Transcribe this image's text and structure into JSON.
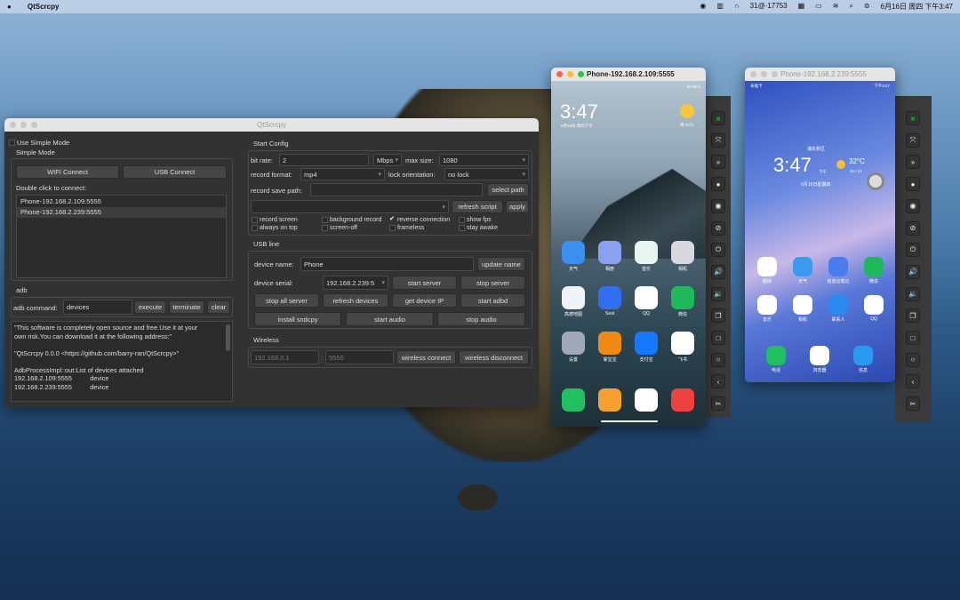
{
  "menubar": {
    "app": "QtScrcpy",
    "status_text": "31@·17753",
    "datetime": "6月16日 周四 下午3:47",
    "icons": [
      "android-icon",
      "bars-icon",
      "headphones-icon",
      "cloud-icon",
      "grid-icon",
      "battery-icon",
      "wifi-icon",
      "search-icon",
      "control-center-icon"
    ]
  },
  "main": {
    "title": "QtScrcpy",
    "use_simple_mode": "Use Simple Mode",
    "simple_mode": "Simple Mode",
    "wifi_connect": "WIFI Connect",
    "usb_connect": "USB Connect",
    "double_click": "Double click to connect:",
    "devices": [
      "Phone-192.168.2.109:5555",
      "Phone-192.168.2.239:5555"
    ],
    "adb": "adb",
    "adb_command_label": "adb command:",
    "adb_command": "devices",
    "execute": "execute",
    "terminate": "terminate",
    "clear": "clear",
    "log": "\"This software is completely open source and free.Use it at your\nown risk.You can download it at the following address:\"\n\n\"QtScrcpy 0.0.0 <https://github.com/barry-ran/QtScrcpy>\"\n\nAdbProcessImpl::out:List of devices attached\n192.168.2.109:5555          device\n192.168.2.239:5555          device",
    "start_config": "Start Config",
    "bit_rate_label": "bit rate:",
    "bit_rate": "2",
    "bit_unit": "Mbps",
    "max_size_label": "max size:",
    "max_size": "1080",
    "record_format_label": "record format:",
    "record_format": "mp4",
    "lock_orientation_label": "lock orientation:",
    "lock_orientation": "no lock",
    "record_save_path_label": "record save path:",
    "record_save_path": "",
    "select_path": "select path",
    "script": "",
    "refresh_script": "refresh script",
    "apply": "apply",
    "checkboxes": [
      {
        "label": "record screen",
        "checked": false
      },
      {
        "label": "background record",
        "checked": false
      },
      {
        "label": "reverse connection",
        "checked": true
      },
      {
        "label": "show fps",
        "checked": false
      },
      {
        "label": "always on top",
        "checked": false
      },
      {
        "label": "screen-off",
        "checked": false
      },
      {
        "label": "frameless",
        "checked": false
      },
      {
        "label": "stay awake",
        "checked": false
      }
    ],
    "usb_line": "USB line",
    "device_name_label": "device name:",
    "device_name": "Phone",
    "update_name": "update name",
    "device_serial_label": "device serial:",
    "device_serial": "192.168.2.239:5",
    "start_server": "start server",
    "stop_server": "stop server",
    "stop_all_server": "stop all server",
    "refresh_devices": "refresh devices",
    "get_device_ip": "get device IP",
    "start_adbd": "start adbd",
    "install_sndcpy": "install sndcpy",
    "start_audio": "start audio",
    "stop_audio": "stop audio",
    "wireless": "Wireless",
    "ip_placeholder": "192.168.0.1",
    "colon": ":",
    "port_placeholder": "5555",
    "wireless_connect": "wireless connect",
    "wireless_disconnect": "wireless disconnect"
  },
  "toolbar_buttons": [
    {
      "icon": "app-switch-icon",
      "glyph": "■"
    },
    {
      "icon": "fullscreen-icon",
      "glyph": "⤧"
    },
    {
      "icon": "expand-notification-icon",
      "glyph": "»"
    },
    {
      "icon": "touch-icon",
      "glyph": "●"
    },
    {
      "icon": "screen-on-icon",
      "glyph": "◉"
    },
    {
      "icon": "screen-off-icon",
      "glyph": "⊘"
    },
    {
      "icon": "power-icon",
      "glyph": "⏻"
    },
    {
      "icon": "volume-up-icon",
      "glyph": "🔊"
    },
    {
      "icon": "volume-down-icon",
      "glyph": "🔉"
    },
    {
      "icon": "app-switch-icon",
      "glyph": "❐"
    },
    {
      "icon": "home-icon",
      "glyph": "□"
    },
    {
      "icon": "circle-home-icon",
      "glyph": "○"
    },
    {
      "icon": "back-icon",
      "glyph": "‹"
    },
    {
      "icon": "screenshot-icon",
      "glyph": "✂"
    }
  ],
  "phone1": {
    "title": "Phone-192.168.2.109:5555",
    "status": "89.9K/s",
    "time": "3:47",
    "date": "6月16日 周四下午",
    "weather": "晴  32°C",
    "apps": [
      {
        "name": "天气",
        "color": "#3a8fef"
      },
      {
        "name": "相册",
        "color": "#8aa0f0"
      },
      {
        "name": "音乐",
        "color": "#e8f4f0"
      },
      {
        "name": "相机",
        "color": "#d8d8e0"
      },
      {
        "name": "高德地图",
        "color": "#f0f4f8"
      },
      {
        "name": "Seal",
        "color": "#2f6ff0"
      },
      {
        "name": "QQ",
        "color": "#ffffff"
      },
      {
        "name": "微信",
        "color": "#1fb85a"
      },
      {
        "name": "设置",
        "color": "#a0a8b8"
      },
      {
        "name": "掌宝宝",
        "color": "#f08a10"
      },
      {
        "name": "支付宝",
        "color": "#1677ff"
      },
      {
        "name": "飞书",
        "color": "#ffffff"
      }
    ],
    "dock": [
      {
        "name": "phone",
        "color": "#20c060"
      },
      {
        "name": "notes",
        "color": "#f6a030"
      },
      {
        "name": "chrome",
        "color": "#ffffff"
      },
      {
        "name": "头条",
        "color": "#f04040"
      }
    ]
  },
  "phone2": {
    "title": "Phone-192.168.2.239:5555",
    "status": "未插卡",
    "status_right": "下午3:47",
    "location": "浦东新区",
    "time": "3:47",
    "ampm": "下午",
    "date": "6月16日星期四",
    "temp": "32°C",
    "range": "34 / 21",
    "apps": [
      {
        "name": "图库",
        "color": "#ffffff"
      },
      {
        "name": "天气",
        "color": "#3a9af0"
      },
      {
        "name": "有道云笔记",
        "color": "#4a7cf0"
      },
      {
        "name": "微信",
        "color": "#1fb85a"
      },
      {
        "name": "音乐",
        "color": "#ffffff"
      },
      {
        "name": "相机",
        "color": "#ffffff"
      },
      {
        "name": "联系人",
        "color": "#2a8af0"
      },
      {
        "name": "QQ",
        "color": "#ffffff"
      }
    ],
    "dock": [
      {
        "name": "电话",
        "color": "#20c060"
      },
      {
        "name": "浏览器",
        "color": "#ffffff"
      },
      {
        "name": "信息",
        "color": "#2a9af0"
      }
    ]
  }
}
